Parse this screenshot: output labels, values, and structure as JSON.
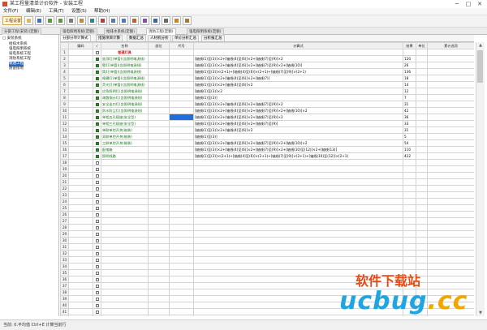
{
  "window": {
    "title": "某工程量清单计价软件 - 安装工程",
    "minimize": "─",
    "maximize": "□",
    "close": "✕"
  },
  "menubar": [
    "文件(F)",
    "编辑(E)",
    "工具(T)",
    "设置(S)",
    "帮助(H)"
  ],
  "toolbar": {
    "first_label": "工程设置",
    "icons": [
      "open-icon",
      "save-icon",
      "undo-icon",
      "redo-icon",
      "copy-icon",
      "paste-icon",
      "insert-icon",
      "delete-icon",
      "up-icon",
      "down-icon",
      "calc-icon",
      "report-icon",
      "search-icon",
      "settings-icon",
      "help-icon",
      "print-icon"
    ]
  },
  "doc_tabs": [
    "分部工程(安装)(定额)",
    "强电照明系统(定额)",
    "给排水系统(定额)",
    "消防工程(定额)",
    "强电照明系统(定额)"
  ],
  "tree": [
    {
      "label": "□ 安装系统",
      "indent": 0
    },
    {
      "label": "给排水系统",
      "indent": 1
    },
    {
      "label": "强电照明系统",
      "indent": 1
    },
    {
      "label": "弱电系统工程",
      "indent": 1
    },
    {
      "label": "消防系统工程",
      "indent": 1
    },
    {
      "label": "暖通工程",
      "indent": 1
    },
    {
      "label": "防雷接地",
      "indent": 1
    }
  ],
  "sub_tabs": [
    "分部分项计算式",
    "措施项目计算",
    "数据汇总",
    "人材机分析",
    "单价分析汇总",
    "分析报汇总"
  ],
  "grid": {
    "headers": [
      "",
      "编码",
      "√",
      "名称",
      "部位",
      "代号",
      "计算式",
      "结果",
      "单位",
      "累计选项"
    ],
    "rows": [
      {
        "n": "1",
        "name": "普通灯具",
        "formula": "",
        "result": "",
        "style": "red",
        "checked": false
      },
      {
        "n": "2",
        "name": "吸顶灯(单管)(含照明电源线)",
        "formula": "[轴线(1)至(3)]×2+[轴线(4)至(6)]×2+[轴线(7)至(9)]×2",
        "result": "120",
        "style": "green",
        "checked": true
      },
      {
        "n": "3",
        "name": "壁灯(单管)(含照明电源线)",
        "formula": "[轴线(1)至(3)]×2+[轴线(4)至(6)]×2+[轴线(7)至(9)]×2+[轴线(10)]",
        "result": "26",
        "style": "green",
        "checked": true
      },
      {
        "n": "4",
        "name": "筒灯(单管)(含照明电源线)",
        "formula": "[轴线(1)至(3)]×(2+1)+[轴线(4)至(6)]×(2+1)+[轴线(7)至(9)]×(2+1)",
        "result": "136",
        "style": "green",
        "checked": true
      },
      {
        "n": "5",
        "name": "格栅灯(单管)(含照明电源线)",
        "formula": "[轴线(1)至(3)]×2+[轴线(4)至(6)]×2+[轴线(7)]",
        "result": "18",
        "style": "green",
        "checked": true
      },
      {
        "n": "6",
        "name": "荧光灯(单管)(含照明电源线)",
        "formula": "[轴线(1)至(3)]×2+[轴线(4)至(6)]×2",
        "result": "14",
        "style": "green",
        "checked": true
      },
      {
        "n": "7",
        "name": "应急照明灯(含照明电源线)",
        "formula": "[轴线(1)至(3)]×2",
        "result": "12",
        "style": "green",
        "checked": true
      },
      {
        "n": "8",
        "name": "疏散指示灯(含照明电源线)",
        "formula": "[轴线(1)至(3)]",
        "result": "7",
        "style": "green",
        "checked": true
      },
      {
        "n": "9",
        "name": "安全出口灯(含照明电源线)",
        "formula": "[轴线(1)至(3)]×2+[轴线(4)至(6)]×2+[轴线(7)至(9)]×2",
        "result": "31",
        "style": "green",
        "checked": true
      },
      {
        "n": "10",
        "name": "防水防尘灯(含照明电源线)",
        "formula": "[轴线(1)至(3)]×2+[轴线(4)至(6)]×2+[轴线(7)至(9)]×2+[轴线(10)]×2",
        "result": "42",
        "style": "green",
        "checked": true
      },
      {
        "n": "11",
        "name": "单相五孔插座(安全型)",
        "formula": "[轴线(1)至(3)]×2+[轴线(4)至(6)]×2+[轴线(7)至(9)]×2",
        "result": "36",
        "style": "green",
        "checked": true,
        "selected": true
      },
      {
        "n": "12",
        "name": "单相三孔插座(安全型)",
        "formula": "[轴线(1)至(3)]×2+[轴线(4)至(6)]×2+[轴线(7)至(9)]",
        "result": "33",
        "style": "green",
        "checked": true
      },
      {
        "n": "13",
        "name": "单联单控开关(暗装)",
        "formula": "[轴线(1)至(3)]×2+[轴线(4)至(6)]×2",
        "result": "31",
        "style": "green",
        "checked": true
      },
      {
        "n": "14",
        "name": "双联单控开关(暗装)",
        "formula": "[轴线(1)至(3)]",
        "result": "5",
        "style": "green",
        "checked": true
      },
      {
        "n": "15",
        "name": "三联单控开关(暗装)",
        "formula": "[轴线(1)至(3)]×2+[轴线(4)至(6)]×2+[轴线(7)至(9)]×2+[轴线(10)]×2",
        "result": "54",
        "style": "green",
        "checked": true
      },
      {
        "n": "16",
        "name": "配电箱",
        "formula": "[轴线(1)至(3)]×2+[轴线(4)至(6)]×2+[轴线(7)至(9)]×2+[轴线(10)至(12)]×2+[轴线(13)]",
        "result": "110",
        "style": "green",
        "checked": true
      },
      {
        "n": "17",
        "name": "照明线路",
        "formula": "[轴线(1)至(3)]×(2+1)+[轴线(4)至(6)]×(2+1)+[轴线(7)至(9)]×(2+1)+[轴线(10)至(12)]×(2+1)",
        "result": "422",
        "style": "green",
        "checked": true
      },
      {
        "n": "18",
        "name": "",
        "formula": "",
        "result": "",
        "style": "",
        "checked": false
      },
      {
        "n": "19",
        "name": "",
        "formula": "",
        "result": "",
        "style": "",
        "checked": false
      },
      {
        "n": "20",
        "name": "",
        "formula": "",
        "result": "",
        "style": "",
        "checked": false
      },
      {
        "n": "21",
        "name": "",
        "formula": "",
        "result": "",
        "style": "",
        "checked": false
      },
      {
        "n": "22",
        "name": "",
        "formula": "",
        "result": "",
        "style": "",
        "checked": false
      },
      {
        "n": "23",
        "name": "",
        "formula": "",
        "result": "",
        "style": "",
        "checked": false
      },
      {
        "n": "24",
        "name": "",
        "formula": "",
        "result": "",
        "style": "",
        "checked": false
      },
      {
        "n": "25",
        "name": "",
        "formula": "",
        "result": "",
        "style": "",
        "checked": false
      },
      {
        "n": "26",
        "name": "",
        "formula": "",
        "result": "",
        "style": "",
        "checked": false
      },
      {
        "n": "27",
        "name": "",
        "formula": "",
        "result": "",
        "style": "",
        "checked": false
      },
      {
        "n": "28",
        "name": "",
        "formula": "",
        "result": "",
        "style": "",
        "checked": false
      },
      {
        "n": "29",
        "name": "",
        "formula": "",
        "result": "",
        "style": "",
        "checked": false
      },
      {
        "n": "30",
        "name": "",
        "formula": "",
        "result": "",
        "style": "",
        "checked": false
      },
      {
        "n": "31",
        "name": "",
        "formula": "",
        "result": "",
        "style": "",
        "checked": false
      },
      {
        "n": "32",
        "name": "",
        "formula": "",
        "result": "",
        "style": "",
        "checked": false
      },
      {
        "n": "33",
        "name": "",
        "formula": "",
        "result": "",
        "style": "",
        "checked": false
      },
      {
        "n": "34",
        "name": "",
        "formula": "",
        "result": "",
        "style": "",
        "checked": false
      },
      {
        "n": "35",
        "name": "",
        "formula": "",
        "result": "",
        "style": "",
        "checked": false
      },
      {
        "n": "36",
        "name": "",
        "formula": "",
        "result": "",
        "style": "",
        "checked": false
      },
      {
        "n": "37",
        "name": "",
        "formula": "",
        "result": "",
        "style": "",
        "checked": false
      },
      {
        "n": "38",
        "name": "",
        "formula": "",
        "result": "",
        "style": "",
        "checked": false
      },
      {
        "n": "39",
        "name": "",
        "formula": "",
        "result": "",
        "style": "",
        "checked": false
      },
      {
        "n": "40",
        "name": "",
        "formula": "",
        "result": "",
        "style": "",
        "checked": false
      },
      {
        "n": "41",
        "name": "",
        "formula": "",
        "result": "",
        "style": "",
        "checked": false
      },
      {
        "n": "42",
        "name": "",
        "formula": "",
        "result": "",
        "style": "",
        "checked": false
      },
      {
        "n": "43",
        "name": "",
        "formula": "",
        "result": "",
        "style": "",
        "checked": false
      },
      {
        "n": "44",
        "name": "",
        "formula": "",
        "result": "",
        "style": "",
        "checked": false
      },
      {
        "n": "45",
        "name": "",
        "formula": "",
        "result": "",
        "style": "",
        "checked": false
      }
    ]
  },
  "scroll": {
    "up": "▲",
    "down": "▼"
  },
  "status": "当前: 0.平均值 Ctrl+E 计算当前行",
  "watermark": {
    "top": "软件下载站",
    "logo_a": "ucbug",
    "logo_b": ".cc"
  },
  "colors": {
    "accent": "#316ac5",
    "selected_cell": "#1e6fd9",
    "green_text": "#117a11",
    "red_text": "#d41b1b"
  }
}
